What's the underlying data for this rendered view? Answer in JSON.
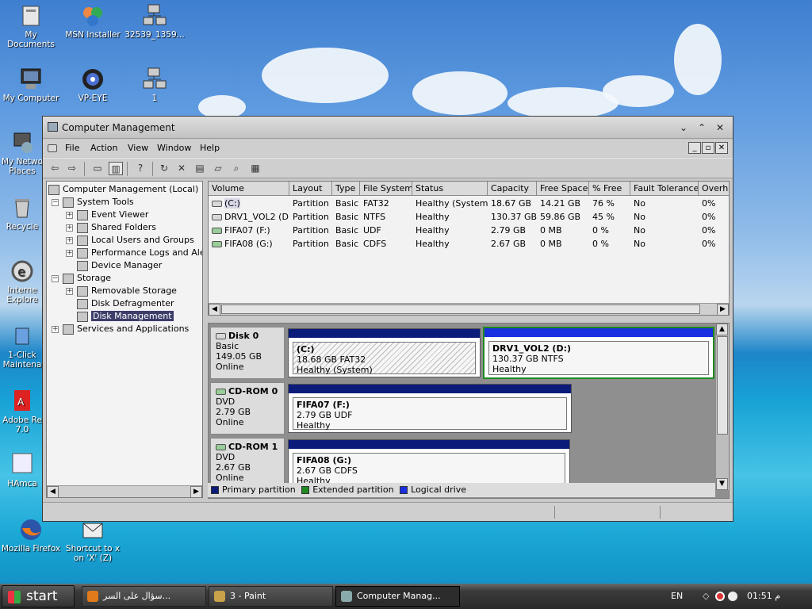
{
  "desktop": {
    "icons": [
      {
        "label": "My Documents"
      },
      {
        "label": "MSN Installer"
      },
      {
        "label": "32539_1359..."
      },
      {
        "label": "My Computer"
      },
      {
        "label": "VP-EYE"
      },
      {
        "label": "1"
      },
      {
        "label": "My Netwo Places"
      },
      {
        "label": "Recycle"
      },
      {
        "label": "Interne Explore"
      },
      {
        "label": "1-Click Maintena"
      },
      {
        "label": "Adobe Re 7.0"
      },
      {
        "label": "HAmca"
      },
      {
        "label": "Mozilla Firefox"
      },
      {
        "label": "Shortcut to x on 'X' (Z)"
      }
    ]
  },
  "window": {
    "title": "Computer Management",
    "menu": [
      "File",
      "Action",
      "View",
      "Window",
      "Help"
    ]
  },
  "tree": {
    "root": "Computer Management (Local)",
    "items": [
      {
        "label": "System Tools"
      },
      {
        "label": "Event Viewer"
      },
      {
        "label": "Shared Folders"
      },
      {
        "label": "Local Users and Groups"
      },
      {
        "label": "Performance Logs and Alerts"
      },
      {
        "label": "Device Manager"
      },
      {
        "label": "Storage"
      },
      {
        "label": "Removable Storage"
      },
      {
        "label": "Disk Defragmenter"
      },
      {
        "label": "Disk Management"
      },
      {
        "label": "Services and Applications"
      }
    ]
  },
  "volumes": {
    "columns": [
      "Volume",
      "Layout",
      "Type",
      "File System",
      "Status",
      "Capacity",
      "Free Space",
      "% Free",
      "Fault Tolerance",
      "Overhe"
    ],
    "rows": [
      [
        "(C:)",
        "Partition",
        "Basic",
        "FAT32",
        "Healthy (System)",
        "18.67 GB",
        "14.21 GB",
        "76 %",
        "No",
        "0%"
      ],
      [
        "DRV1_VOL2 (D:)",
        "Partition",
        "Basic",
        "NTFS",
        "Healthy",
        "130.37 GB",
        "59.86 GB",
        "45 %",
        "No",
        "0%"
      ],
      [
        "FIFA07 (F:)",
        "Partition",
        "Basic",
        "UDF",
        "Healthy",
        "2.79 GB",
        "0 MB",
        "0 %",
        "No",
        "0%"
      ],
      [
        "FIFA08 (G:)",
        "Partition",
        "Basic",
        "CDFS",
        "Healthy",
        "2.67 GB",
        "0 MB",
        "0 %",
        "No",
        "0%"
      ]
    ]
  },
  "disks": [
    {
      "name": "Disk 0",
      "type": "Basic",
      "size": "149.05 GB",
      "state": "Online",
      "partitions": [
        {
          "title": "(C:)",
          "detail": "18.68 GB FAT32",
          "status": "Healthy (System)"
        },
        {
          "title": "DRV1_VOL2  (D:)",
          "detail": "130.37 GB NTFS",
          "status": "Healthy"
        }
      ]
    },
    {
      "name": "CD-ROM 0",
      "type": "DVD",
      "size": "2.79 GB",
      "state": "Online",
      "partitions": [
        {
          "title": "FIFA07  (F:)",
          "detail": "2.79 GB UDF",
          "status": "Healthy"
        }
      ]
    },
    {
      "name": "CD-ROM 1",
      "type": "DVD",
      "size": "2.67 GB",
      "state": "Online",
      "partitions": [
        {
          "title": "FIFA08  (G:)",
          "detail": "2.67 GB CDFS",
          "status": "Healthy"
        }
      ]
    }
  ],
  "legend": [
    {
      "label": "Primary partition",
      "color": "#0b1b7a"
    },
    {
      "label": "Extended partition",
      "color": "#1f8a1f"
    },
    {
      "label": "Logical drive",
      "color": "#1a2fe0"
    }
  ],
  "taskbar": {
    "start": "start",
    "tasks": [
      "سؤال على السر...",
      "3 - Paint",
      "Computer Manag..."
    ],
    "lang": "EN",
    "clock": "01:51 م"
  }
}
